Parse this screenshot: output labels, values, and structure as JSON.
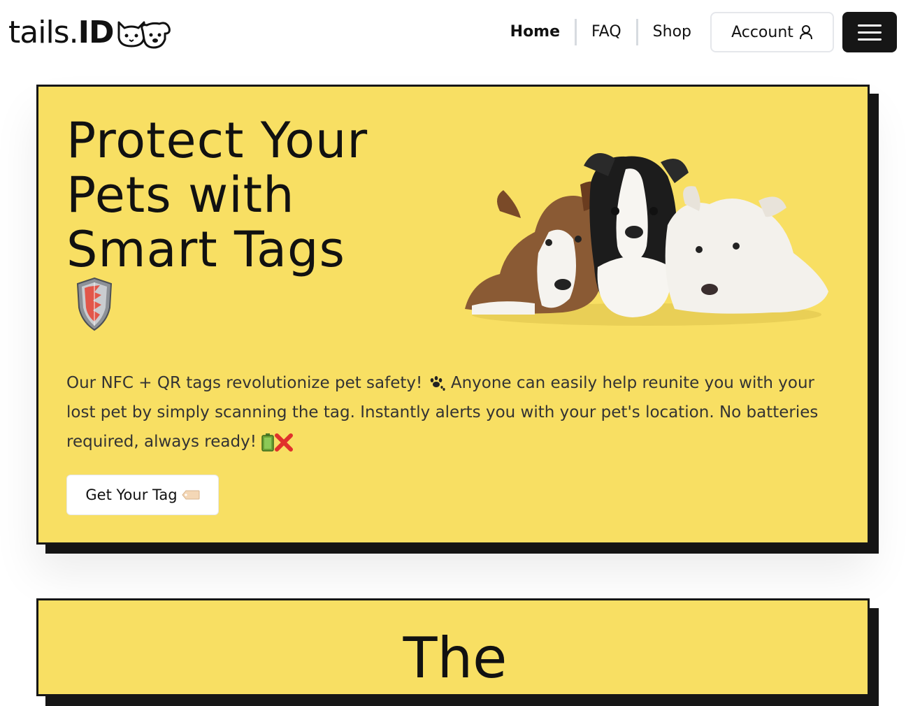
{
  "header": {
    "logo": {
      "text_regular": "tails.",
      "text_bold": "ID",
      "icon": "cat-dog-icon"
    },
    "nav": [
      {
        "label": "Home",
        "active": true
      },
      {
        "label": "FAQ",
        "active": false
      },
      {
        "label": "Shop",
        "active": false
      }
    ],
    "account_label": "Account",
    "account_icon": "user-icon",
    "menu_icon": "hamburger-menu-icon"
  },
  "hero": {
    "title": "Protect Your Pets with Smart Tags",
    "title_icon": "shield-icon",
    "image": "puppies-photo",
    "description_part1": "Our NFC + QR tags revolutionize pet safety! ",
    "description_part2": " Anyone can easily help reunite you with your lost pet by simply scanning the tag. Instantly alerts you with your pet's location. No batteries required, always ready! ",
    "cta_label": "Get Your Tag",
    "cta_icon": "tag-icon"
  },
  "second_section": {
    "title": "The"
  },
  "colors": {
    "card_background": "#f8df63",
    "card_border": "#161616",
    "menu_button": "#161616",
    "page_background": "#ffffff"
  }
}
